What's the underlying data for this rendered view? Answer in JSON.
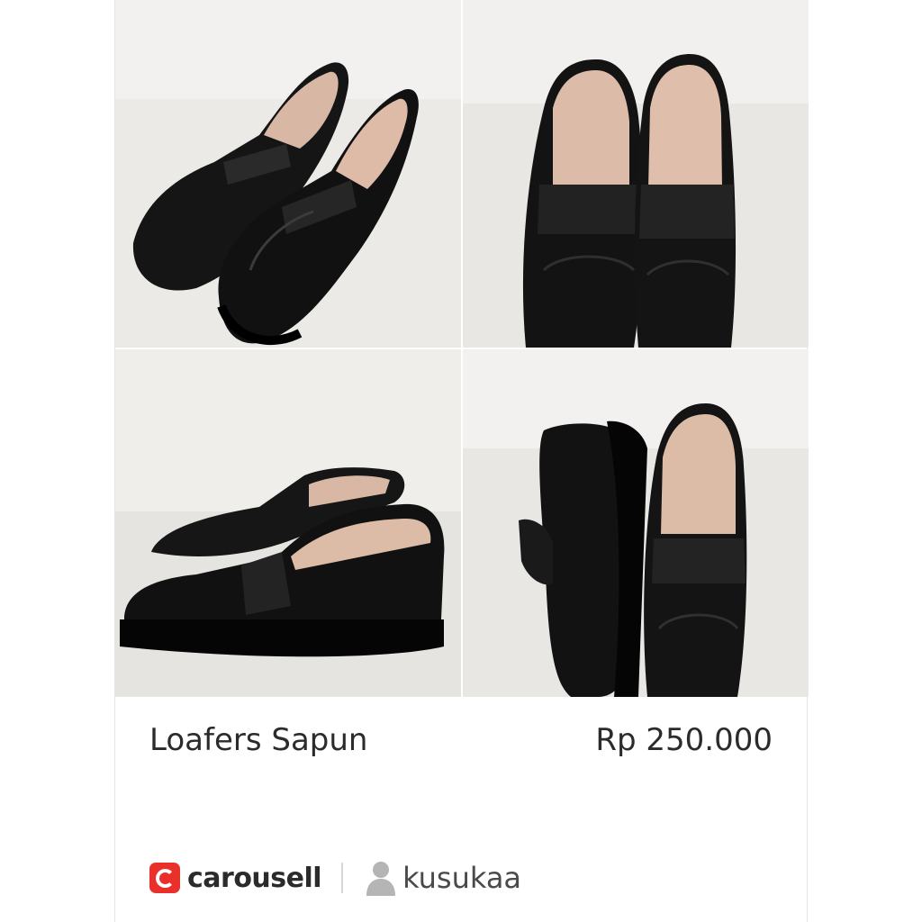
{
  "listing": {
    "title": "Loafers Sapun",
    "price": "Rp 250.000"
  },
  "photos": [
    {
      "icon": "loafers-pair-angle-photo"
    },
    {
      "icon": "loafers-pair-front-photo"
    },
    {
      "icon": "loafers-pair-side-photo"
    },
    {
      "icon": "loafers-sole-and-front-photo"
    }
  ],
  "footer": {
    "brand": "carousell",
    "brand_icon": "carousell-logo-icon",
    "username": "kusukaa",
    "user_icon": "user-icon"
  },
  "colors": {
    "brand_red": "#e9302b",
    "text": "#2b2b2b",
    "photo_bg": "#e3e1dd",
    "shoe": "#141414"
  }
}
